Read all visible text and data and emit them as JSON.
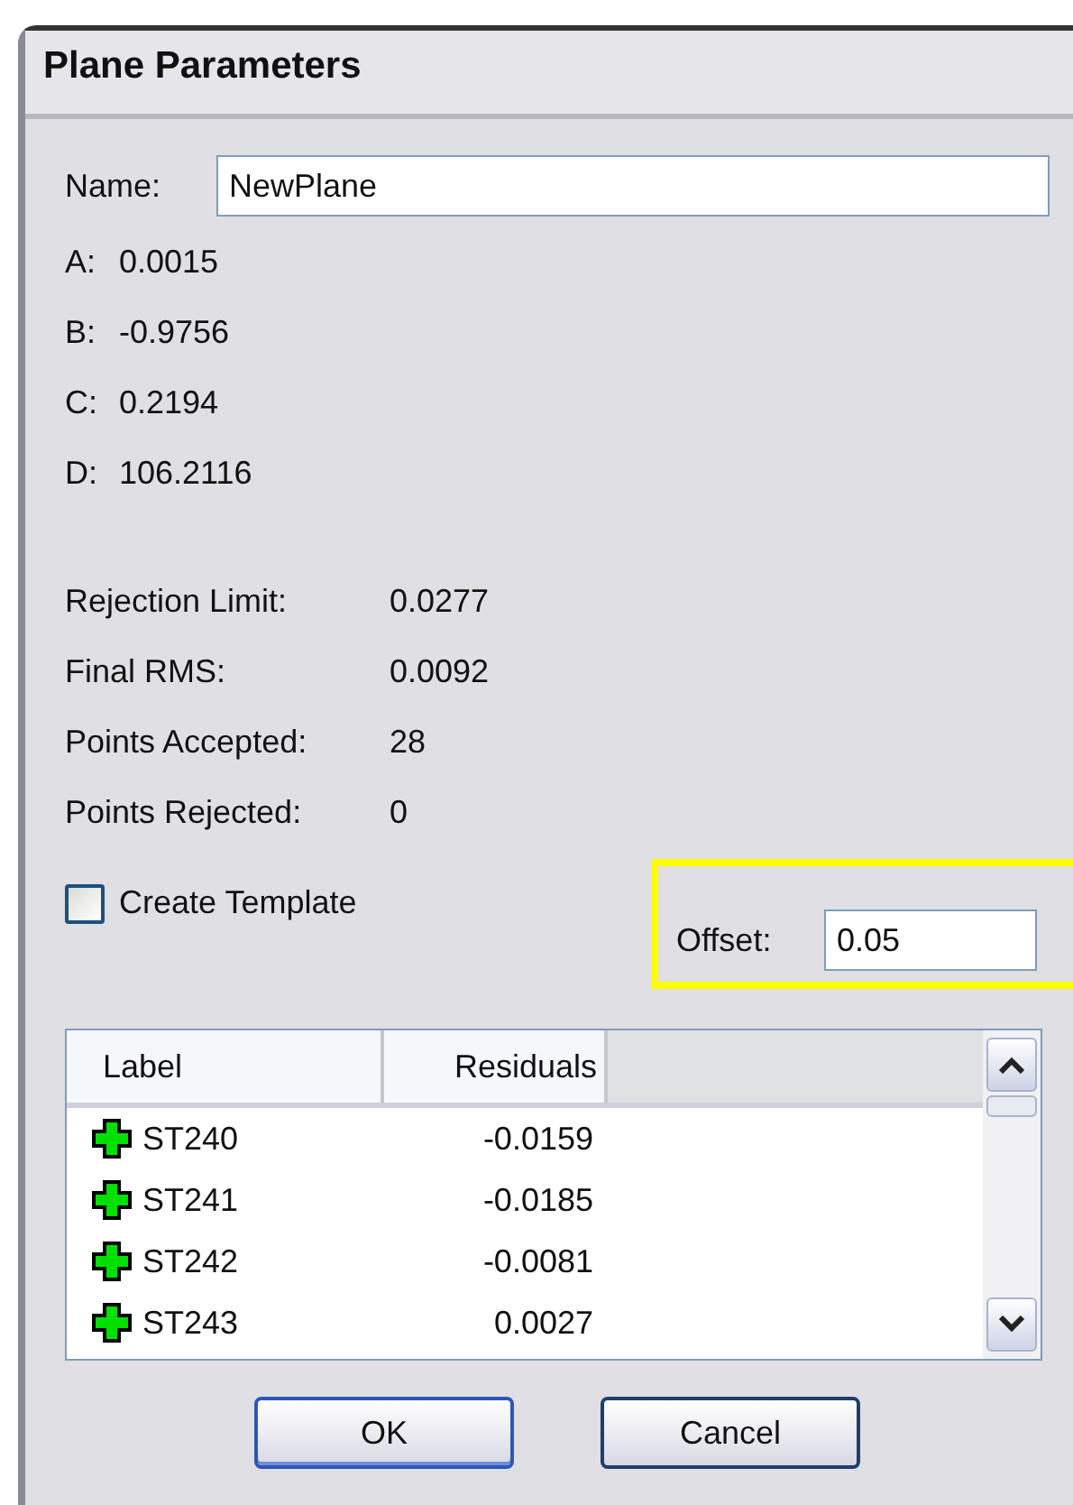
{
  "window": {
    "title": "Plane Parameters"
  },
  "name_field": {
    "label": "Name:",
    "value": "NewPlane"
  },
  "coefficients": [
    {
      "label": "A:",
      "value": "0.0015"
    },
    {
      "label": "B:",
      "value": "-0.9756"
    },
    {
      "label": "C:",
      "value": "0.2194"
    },
    {
      "label": "D:",
      "value": "106.2116"
    }
  ],
  "stats": [
    {
      "label": "Rejection Limit:",
      "value": "0.0277"
    },
    {
      "label": "Final RMS:",
      "value": "0.0092"
    },
    {
      "label": "Points Accepted:",
      "value": "28"
    },
    {
      "label": "Points Rejected:",
      "value": "0"
    }
  ],
  "create_template": {
    "label": "Create Template",
    "checked": false
  },
  "offset": {
    "label": "Offset:",
    "value": "0.05",
    "highlighted": true
  },
  "table": {
    "columns": [
      "Label",
      "Residuals"
    ],
    "rows": [
      {
        "label": "ST240",
        "residual": "-0.0159"
      },
      {
        "label": "ST241",
        "residual": "-0.0185"
      },
      {
        "label": "ST242",
        "residual": "-0.0081"
      },
      {
        "label": "ST243",
        "residual": "0.0027"
      }
    ]
  },
  "buttons": [
    {
      "label": "OK",
      "default": true
    },
    {
      "label": "Cancel",
      "default": false
    }
  ]
}
